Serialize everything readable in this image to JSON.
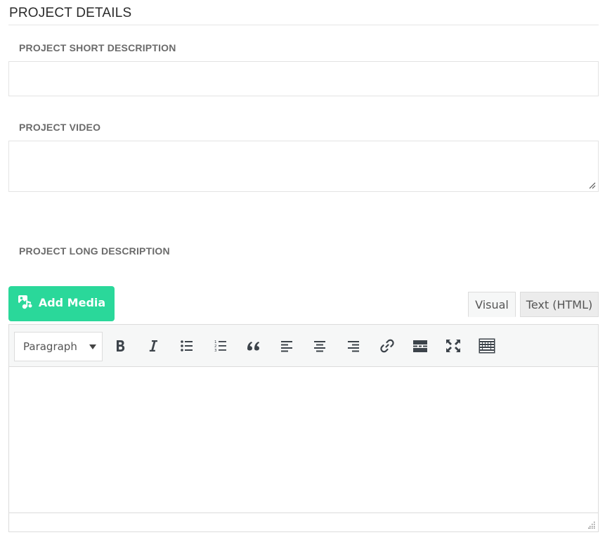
{
  "section": {
    "title": "PROJECT DETAILS"
  },
  "short_description": {
    "label": "PROJECT SHORT DESCRIPTION",
    "value": ""
  },
  "video": {
    "label": "PROJECT VIDEO",
    "value": ""
  },
  "long_description": {
    "label": "PROJECT LONG DESCRIPTION",
    "add_media_label": "Add Media",
    "tabs": {
      "visual": "Visual",
      "text": "Text (HTML)"
    },
    "format_select": "Paragraph",
    "content": ""
  },
  "colors": {
    "accent": "#2ad89a",
    "label": "#6b6b6b",
    "border": "#dcdcdc"
  },
  "icons": [
    "add-media-icon",
    "bold-icon",
    "italic-icon",
    "bullet-list-icon",
    "numbered-list-icon",
    "blockquote-icon",
    "align-left-icon",
    "align-center-icon",
    "align-right-icon",
    "link-icon",
    "read-more-icon",
    "fullscreen-icon",
    "toolbar-toggle-icon",
    "resize-grip-icon"
  ]
}
